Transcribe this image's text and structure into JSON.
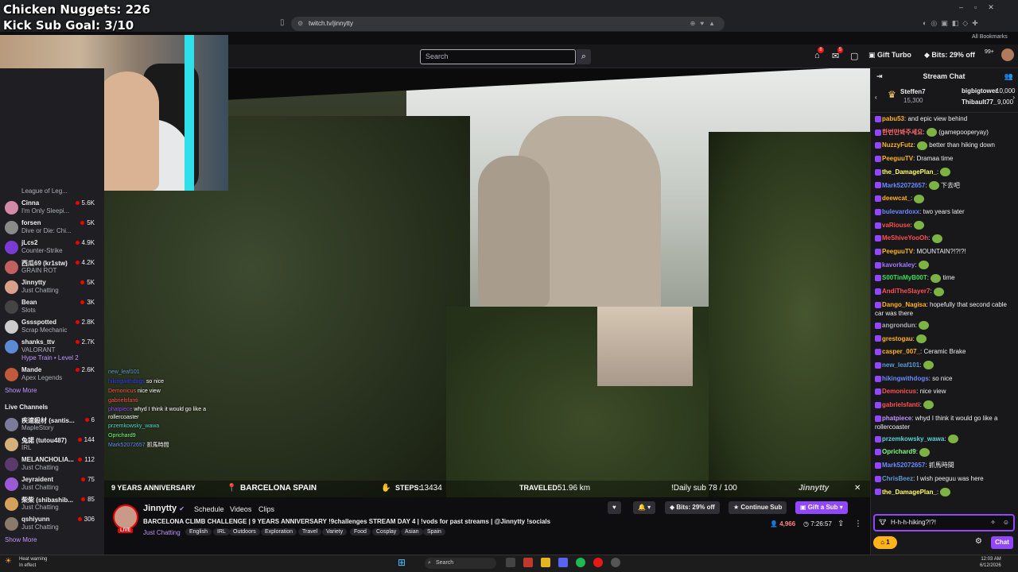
{
  "overlay": {
    "line1": "Chicken Nuggets: 226",
    "line2": "Kick Sub Goal: 3/10"
  },
  "browser": {
    "url": "twitch.tv/jinnytty",
    "bookmarks": "All Bookmarks"
  },
  "nav": {
    "search_placeholder": "Search",
    "notif_count": "8",
    "whisper_count": "5",
    "gift_turbo": "Gift Turbo",
    "bits_offer": "Bits: 29% off",
    "points": "99+"
  },
  "sidebar": {
    "top_partial_game": "League of Leg...",
    "followed": [
      {
        "name": "Cinna",
        "game": "I'm Only Sleepi...",
        "viewers": "5.6K",
        "color": "#d48aa6"
      },
      {
        "name": "forsen",
        "game": "Dive or Die: Chi...",
        "viewers": "5K",
        "color": "#8a8a8a"
      },
      {
        "name": "jLcs2",
        "game": "Counter-Strike",
        "viewers": "4.9K",
        "color": "#7a3bd4"
      },
      {
        "name": "西瓜69 (kr1stw)",
        "game": "GRAIN ROT",
        "viewers": "4.2K",
        "color": "#c06060"
      },
      {
        "name": "Jinnytty",
        "game": "Just Chatting",
        "viewers": "5K",
        "color": "#d9a08a"
      },
      {
        "name": "Bean",
        "game": "Slots",
        "viewers": "3K",
        "color": "#444444"
      },
      {
        "name": "Gssspotted",
        "game": "Scrap Mechanic",
        "viewers": "2.8K",
        "color": "#cccccc"
      },
      {
        "name": "shanks_ttv",
        "game": "VALORANT",
        "viewers": "2.7K",
        "color": "#5b8bd4"
      },
      {
        "name": "Mande",
        "game": "Apex Legends",
        "viewers": "2.6K",
        "color": "#c05a3a"
      }
    ],
    "hype_train": "Hype Train • Level 2",
    "show_more": "Show More",
    "live_header": "Live Channels",
    "live": [
      {
        "name": "疾速殺材 (santis...",
        "game": "MapleStory",
        "viewers": "6",
        "color": "#7a7a9a"
      },
      {
        "name": "兔諾 (tutou487)",
        "game": "IRL",
        "viewers": "144",
        "color": "#d4b07a"
      },
      {
        "name": "MELANCHOLIA...",
        "game": "Just Chatting",
        "viewers": "112",
        "color": "#5a3a6a"
      },
      {
        "name": "Jeyraident",
        "game": "Just Chatting",
        "viewers": "75",
        "color": "#9a5ad4"
      },
      {
        "name": "柴柴 (shibashib...",
        "game": "Just Chatting",
        "viewers": "85",
        "color": "#d4a05a"
      },
      {
        "name": "qshiyunn",
        "game": "Just Chatting",
        "viewers": "306",
        "color": "#8a7a6a"
      }
    ],
    "show_more_live": "Show More"
  },
  "video_overlay": {
    "chat": [
      {
        "user": "new_leaf101",
        "text": "",
        "color": "#5b9bd5"
      },
      {
        "user": "hikingwithdogs",
        "text": "so nice",
        "color": "#3a3aff"
      },
      {
        "user": "Demonicus",
        "text": "nice view",
        "color": "#ff5050"
      },
      {
        "user": "gabrielsfanti",
        "text": "",
        "color": "#ff5050"
      },
      {
        "user": "phatpiece",
        "text": "whyd I think it would go like a rollercoaster",
        "color": "#9147ff"
      },
      {
        "user": "przemkowsky_wawa",
        "text": "",
        "color": "#5ad4d4"
      },
      {
        "user": "Oprichard9",
        "text": "",
        "color": "#7cff7c"
      },
      {
        "user": "Mark52072657",
        "text": "抓馬時間",
        "color": "#6a8aff"
      }
    ],
    "anniversary": "9 YEARS ANNIVERSARY",
    "location": "BARCELONA SPAIN",
    "steps_label": "STEPS:",
    "steps_value": "13434",
    "traveled_label": "TRAVELED:",
    "traveled_value": "51.96 km",
    "daily_sub": "!Daily sub 78 / 100",
    "watermark": "Jinnytty"
  },
  "stream": {
    "channel": "Jinnytty",
    "live": "LIVE",
    "tabs": [
      "Schedule",
      "Videos",
      "Clips"
    ],
    "title": "BARCELONA CLIMB CHALLENGE | 9 YEARS ANNIVERSARY !9challenges STREAM DAY 4 | !vods for past streams | @Jinnytty !socials",
    "category": "Just Chatting",
    "tags": [
      "English",
      "IRL",
      "Outdoors",
      "Exploration",
      "Travel",
      "Variety",
      "Food",
      "Cosplay",
      "Asian",
      "Spain"
    ],
    "bits_offer": "Bits: 29% off",
    "continue_sub": "Continue Sub",
    "gift_sub": "Gift a Sub",
    "viewers": "4,966",
    "uptime": "7:26:57"
  },
  "chat": {
    "header": "Stream Chat",
    "leaders": [
      {
        "name": "Steffen7",
        "score": "15,300"
      },
      {
        "name": "bigbigtower",
        "score": "10,000"
      },
      {
        "name": "Thibault77_",
        "score": "9,000"
      }
    ],
    "messages": [
      {
        "user": "pabu53",
        "text": "and epic view behind",
        "color": "#ffb31a",
        "emote": false
      },
      {
        "user": "한번만봐주세요",
        "text": "(gamepooperyay)",
        "color": "#ff6a6a",
        "emote": true
      },
      {
        "user": "NuzzyFutz",
        "text": "better than hiking down",
        "color": "#ffb31a",
        "emote": true
      },
      {
        "user": "PeeguuTV",
        "text": "Dramaa time",
        "color": "#ffb31a",
        "emote": false
      },
      {
        "user": "the_DamagePlan_",
        "text": "",
        "color": "#ffff66",
        "emote": true
      },
      {
        "user": "Mark52072657",
        "text": "下去吧",
        "color": "#6a8aff",
        "emote": true
      },
      {
        "user": "deewcat_",
        "text": "",
        "color": "#ffb31a",
        "emote": true
      },
      {
        "user": "bulevardoxx",
        "text": "two years later",
        "color": "#6a8aff",
        "emote": false
      },
      {
        "user": "vaRiouse",
        "text": "",
        "color": "#ff5050",
        "emote": true
      },
      {
        "user": "MeShiveYooOh",
        "text": "",
        "color": "#ff5050",
        "emote": true
      },
      {
        "user": "PeeguuTV",
        "text": "MOUNTAIN?!?!?!",
        "color": "#ffb31a",
        "emote": false
      },
      {
        "user": "kavorkaley",
        "text": "",
        "color": "#9f7aff",
        "emote": true
      },
      {
        "user": "S00TinMyB00T",
        "text": "time",
        "color": "#3adf5a",
        "emote": true
      },
      {
        "user": "AndiTheSlayer7",
        "text": "",
        "color": "#ff5050",
        "emote": true
      },
      {
        "user": "Dango_Nagisa",
        "text": "hopefully that second cable car was there",
        "color": "#ffb31a",
        "emote": false
      },
      {
        "user": "angrondun",
        "text": "",
        "color": "#adadb8",
        "emote": true
      },
      {
        "user": "grestogau",
        "text": "",
        "color": "#ffb31a",
        "emote": true
      },
      {
        "user": "casper_007_",
        "text": "Ceramic Brake",
        "color": "#ffb31a",
        "emote": false
      },
      {
        "user": "new_leaf101",
        "text": "",
        "color": "#5b9bd5",
        "emote": true
      },
      {
        "user": "hikingwithdogs",
        "text": "so nice",
        "color": "#6a8aff",
        "emote": false
      },
      {
        "user": "Demonicus",
        "text": "nice view",
        "color": "#ff5050",
        "emote": false
      },
      {
        "user": "gabrielsfanti",
        "text": "",
        "color": "#ff5050",
        "emote": true
      },
      {
        "user": "phatpiece",
        "text": "whyd I think it would go like a rollercoaster",
        "color": "#bf94ff",
        "emote": false
      },
      {
        "user": "przemkowsky_wawa",
        "text": "",
        "color": "#5ad4d4",
        "emote": true
      },
      {
        "user": "Oprichard9",
        "text": "",
        "color": "#7cff7c",
        "emote": true
      },
      {
        "user": "Mark52072657",
        "text": "抓馬時間",
        "color": "#6a8aff",
        "emote": false
      },
      {
        "user": "ChrisBeez",
        "text": "I wish peeguu was here",
        "color": "#5b9bd5",
        "emote": false
      },
      {
        "user": "the_DamagePlan_",
        "text": "",
        "color": "#ffff66",
        "emote": true
      }
    ],
    "input_value": "H-h-h-hiking?!?!",
    "points": "1",
    "send": "Chat"
  },
  "taskbar": {
    "warning_line1": "Heat warning",
    "warning_line2": "In effect",
    "search": "Search",
    "time": "12:03 AM",
    "date": "6/12/2026"
  }
}
